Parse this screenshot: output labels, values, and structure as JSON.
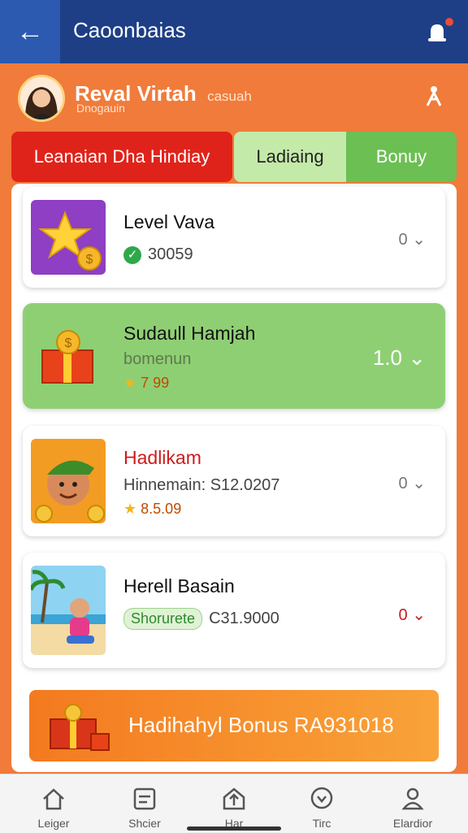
{
  "header": {
    "title": "Caoonbaias",
    "back_icon": "arrow-left-icon",
    "notify_icon": "bell-icon"
  },
  "profile": {
    "name": "Reval Virtah",
    "tag": "casuah",
    "subtitle": "Dnogauin"
  },
  "tabs": [
    {
      "label": "Leanaian Dha Hindiay",
      "active": true
    },
    {
      "label": "Ladiaing",
      "active": false
    },
    {
      "label": "Bonuy",
      "active": false
    }
  ],
  "cards": [
    {
      "title": "Level Vava",
      "line": "30059",
      "right": "0"
    },
    {
      "title": "Sudaull Hamjah",
      "line": "bomenun",
      "line2": "7 99",
      "right": "1.0"
    },
    {
      "title": "Hadlikam",
      "line": "Hinnemain: S12.0207",
      "line2": "8.5.09",
      "right": "0"
    },
    {
      "title": "Herell Basain",
      "badge": "Shorurete",
      "line": "C31.9000",
      "right": "0"
    }
  ],
  "bonus": {
    "label": "Hadihahyl Bonus RA931018"
  },
  "nav": [
    {
      "label": "Leiger",
      "icon": "home-icon"
    },
    {
      "label": "Shcier",
      "icon": "list-icon"
    },
    {
      "label": "Har",
      "icon": "upload-icon"
    },
    {
      "label": "Tirc",
      "icon": "heart-icon"
    },
    {
      "label": "Elardior",
      "icon": "user-icon"
    }
  ],
  "colors": {
    "header": "#1e3f86",
    "background": "#f07b3a",
    "active_tab": "#e0231a",
    "green": "#6cbf53"
  }
}
